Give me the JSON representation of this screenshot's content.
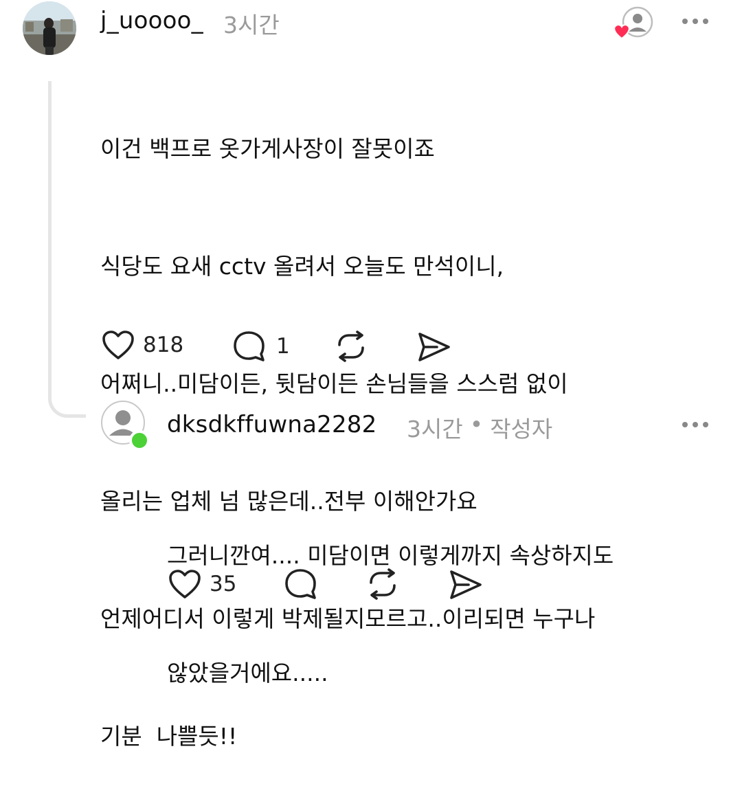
{
  "comments": [
    {
      "username": "j_uoooo_",
      "time": "3시간",
      "author_badge": "",
      "lines": [
        "이건 백프로 옷가게사장이 잘못이죠",
        "식당도 요새 cctv 올려서 오늘도 만석이니,",
        "어쩌니..미담이든, 뒷담이든 손님들을 스스럼 없이",
        "올리는 업체 넘 많은데..전부 이해안가요",
        "언제어디서 이렇게 박제될지모르고..이리되면 누구나",
        "기분  나쁠듯!!"
      ],
      "likes": "818",
      "replies": "1",
      "icons": [
        "heart-icon",
        "comment-icon",
        "repost-icon",
        "share-icon",
        "more-icon"
      ]
    },
    {
      "username": "dksdkffuwna2282",
      "time": "3시간",
      "author_badge": "작성자",
      "separator": "•",
      "lines": [
        "그러니깐여.... 미담이면 이렇게까지 속상하지도",
        "않았을거에요....."
      ],
      "likes": "35",
      "replies": "",
      "online_color": "#4cd137",
      "icons": [
        "heart-icon",
        "comment-icon",
        "repost-icon",
        "share-icon",
        "more-icon"
      ]
    }
  ],
  "colors": {
    "heart": "#ff2d55",
    "meta": "#9a9a9a",
    "online": "#4cd137"
  }
}
